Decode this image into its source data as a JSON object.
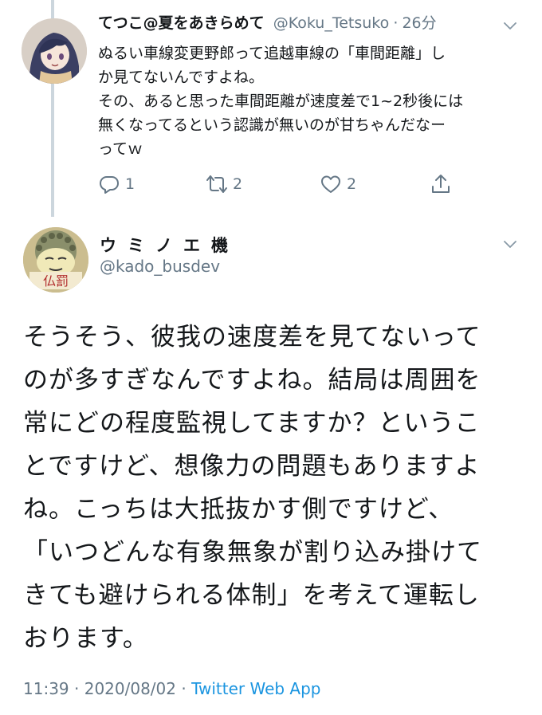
{
  "reply_tweet": {
    "display_name": "てつこ@夏をあきらめて",
    "handle": "@Koku_Tetsuko",
    "separator": "·",
    "time_ago": "26分",
    "text_lines": [
      "ぬるい車線変更野郎って追越車線の「車間距離」し",
      "か見てないんですよね。",
      "その、あると思った車間距離が速度差で1~2秒後には",
      "無くなってるという認識が無いのが甘ちゃんだなー",
      "ってｗ"
    ],
    "actions": {
      "reply_count": "1",
      "retweet_count": "2",
      "like_count": "2"
    },
    "icons": {
      "reply": "reply-icon",
      "retweet": "retweet-icon",
      "like": "heart-icon",
      "share": "share-icon",
      "menu": "chevron-down-icon"
    }
  },
  "main_tweet": {
    "display_name": "ウミノエ機",
    "handle": "@kado_busdev",
    "avatar_stamp": "仏罰",
    "text_lines": [
      "そうそう、彼我の速度差を見てないって",
      "のが多すぎなんですよね。結局は周囲を",
      "常にどの程度監視してますか？というこ",
      "とですけど、想像力の問題もありますよ",
      "ね。こっちは大抵抜かす側ですけど、",
      "「いつどんな有象無象が割り込み掛けて",
      "きても避けられる体制」を考えて運転し",
      "おります。"
    ],
    "time": "11:39",
    "separator1": "·",
    "date": "2020/08/02",
    "separator2": "·",
    "source_app": "Twitter Web App"
  },
  "colors": {
    "text": "#14171a",
    "secondary": "#657786",
    "link": "#1b95e0",
    "thread_line": "#ccd6dd"
  }
}
